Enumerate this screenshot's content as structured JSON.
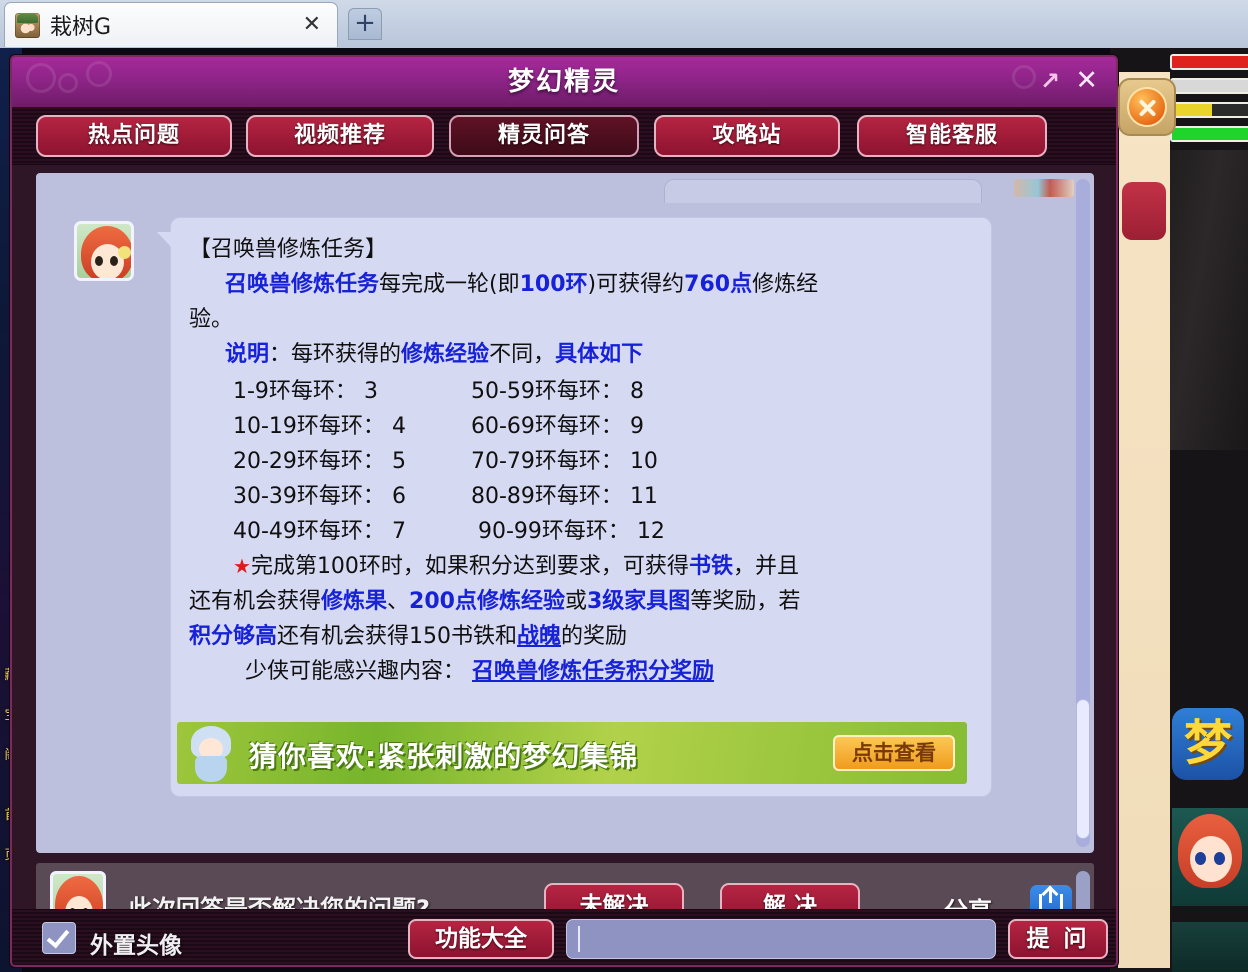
{
  "browser": {
    "tab_title": "栽树G",
    "close_label": "✕",
    "newtab_label": "+"
  },
  "window": {
    "title": "梦幻精灵",
    "expand_icon": "↗",
    "close_icon": "✕"
  },
  "nav": {
    "items": [
      {
        "label": "热点问题",
        "active": false
      },
      {
        "label": "视频推荐",
        "active": false
      },
      {
        "label": "精灵问答",
        "active": true
      },
      {
        "label": "攻略站",
        "active": false
      },
      {
        "label": "智能客服",
        "active": false
      }
    ]
  },
  "answer": {
    "heading": "【召唤兽修炼任务】",
    "intro": {
      "link1": "召唤兽修炼任务",
      "t1": "每完成一轮(即",
      "v_rounds": "100环",
      "t2": ")可获得约",
      "v_exp": "760点",
      "t3": "修炼经",
      "t4": "验。"
    },
    "explain": {
      "label": "说明",
      "colon": "：",
      "t1": "每环获得的",
      "link": "修炼经验",
      "t2": "不同，",
      "tail": "具体如下"
    },
    "ring_rows": [
      {
        "left_range": "1-9环每环：",
        "left_value": "3",
        "right_range": "50-59环每环：",
        "right_value": "8"
      },
      {
        "left_range": "10-19环每环：",
        "left_value": "4",
        "right_range": "60-69环每环：",
        "right_value": "9"
      },
      {
        "left_range": "20-29环每环：",
        "left_value": "5",
        "right_range": "70-79环每环：",
        "right_value": "10"
      },
      {
        "left_range": "30-39环每环：",
        "left_value": "6",
        "right_range": "80-89环每环：",
        "right_value": "11"
      },
      {
        "left_range": "40-49环每环：",
        "left_value": "7",
        "right_range": "90-99环每环：",
        "right_value": "12"
      }
    ],
    "reward": {
      "star": "★",
      "t1": "完成第100环时，如果积分达到要求，可获得",
      "link1": "书铁",
      "t2": "，并且",
      "t3": "还有机会获得",
      "link2": "修炼果",
      "t4": "、",
      "link3": "200点修炼经验",
      "t5": "或",
      "link4": "3级家具图",
      "t6": "等奖励，若",
      "link5": "积分够高",
      "t7": "还有机会获得150书铁和",
      "link6": "战魄",
      "t8": "的奖励"
    },
    "related": {
      "label": "少侠可能感兴趣内容：",
      "link": "召唤兽修炼任务积分奖励"
    }
  },
  "banner": {
    "text": "猜你喜欢:紧张刺激的梦幻集锦",
    "button": "点击查看"
  },
  "feedback": {
    "question": "此次回答是否解决您的问题?",
    "unsolved": "未解决",
    "solved": "解 决",
    "share_label": "分享"
  },
  "bottom": {
    "checkbox_label": "外置头像",
    "checkbox_checked": true,
    "functions_button": "功能大全",
    "input_value": "",
    "input_placeholder": "",
    "ask_button": "提 问"
  },
  "game": {
    "app_icon_label": "梦",
    "left_strip_text": [
      "藏",
      "宝",
      "阁",
      "首",
      "页"
    ],
    "hp_bars": [
      {
        "name": "hp",
        "color": "#e0221f",
        "percent": 100
      },
      {
        "name": "mp",
        "color": "#d8d8d8",
        "percent": 100
      },
      {
        "name": "exp",
        "color": "#e8d42a",
        "percent": 46
      },
      {
        "name": "sp",
        "color": "#1fd42a",
        "percent": 100
      }
    ]
  },
  "colors": {
    "title_purple": "#8e2488",
    "button_crimson": "#b52542",
    "link_blue": "#1722d8",
    "chat_bg": "#bcc0dd",
    "bubble_bg": "#d6d9f2"
  }
}
